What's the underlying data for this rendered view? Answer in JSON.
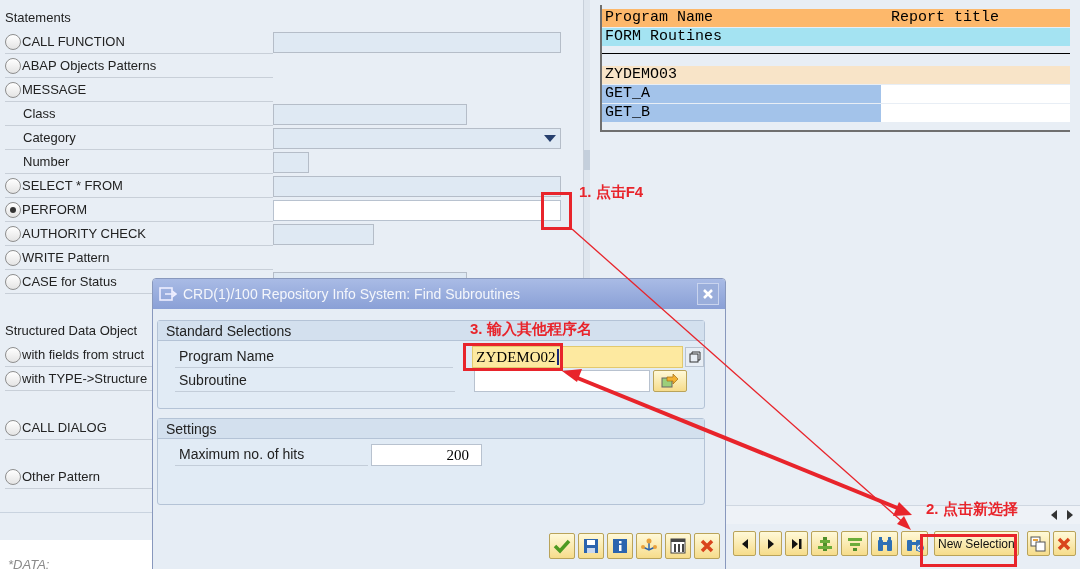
{
  "pattern_sections": [
    {
      "heading": "Statements",
      "items": [
        {
          "kind": "radio",
          "label": "CALL FUNCTION",
          "selected": false,
          "field": {
            "kind": "long",
            "editable": false
          }
        },
        {
          "kind": "radio",
          "label": "ABAP Objects Patterns",
          "selected": false
        },
        {
          "kind": "radio",
          "label": "MESSAGE",
          "selected": false
        },
        {
          "kind": "sub",
          "label": "Class",
          "field": {
            "kind": "medium",
            "editable": false
          }
        },
        {
          "kind": "sub",
          "label": "Category",
          "field": {
            "kind": "dropdown",
            "editable": false
          }
        },
        {
          "kind": "sub",
          "label": "Number",
          "field": {
            "kind": "tiny",
            "editable": false
          }
        },
        {
          "kind": "radio",
          "label": "SELECT * FROM",
          "selected": false,
          "field": {
            "kind": "long",
            "editable": false
          }
        },
        {
          "kind": "radio",
          "label": "PERFORM",
          "selected": true,
          "field": {
            "kind": "long",
            "editable": true
          }
        },
        {
          "kind": "radio",
          "label": "AUTHORITY CHECK",
          "selected": false,
          "field": {
            "kind": "short",
            "editable": false
          }
        },
        {
          "kind": "radio",
          "label": "WRITE Pattern",
          "selected": false
        },
        {
          "kind": "radio",
          "label": "CASE for Status",
          "selected": false,
          "field": {
            "kind": "medium",
            "editable": false
          }
        }
      ]
    },
    {
      "heading": "Structured Data Object",
      "items": [
        {
          "kind": "radio",
          "label": "with fields from struct",
          "selected": false
        },
        {
          "kind": "radio",
          "label": "with TYPE->Structure",
          "selected": false
        }
      ]
    },
    {
      "items": [
        {
          "kind": "radio",
          "label": "CALL DIALOG",
          "selected": false
        }
      ]
    },
    {
      "items": [
        {
          "kind": "radio",
          "label": "Other Pattern",
          "selected": false
        }
      ]
    }
  ],
  "editor_line": "*DATA:",
  "result_list": {
    "columns": [
      "Program Name",
      "Report title"
    ],
    "section": "FORM Routines",
    "program": "ZYDEMO03",
    "routines": [
      "GET_A",
      "GET_B"
    ]
  },
  "toolbar": {
    "new_selection": "New Selection"
  },
  "dialog": {
    "title": "CRD(1)/100 Repository Info System: Find Subroutines",
    "groups": [
      {
        "title": "Standard Selections",
        "fields": [
          {
            "label": "Program Name",
            "value": "ZYDEMO02",
            "focused": true
          },
          {
            "label": "Subroutine",
            "focused": false
          }
        ]
      },
      {
        "title": "Settings",
        "fields": [
          {
            "label": "Maximum no. of hits",
            "value": "200",
            "focused": false
          }
        ]
      }
    ]
  },
  "annotations": [
    {
      "text": "1. 点击F4"
    },
    {
      "text": "2. 点击新选择"
    },
    {
      "text": "3. 输入其他程序名"
    }
  ]
}
